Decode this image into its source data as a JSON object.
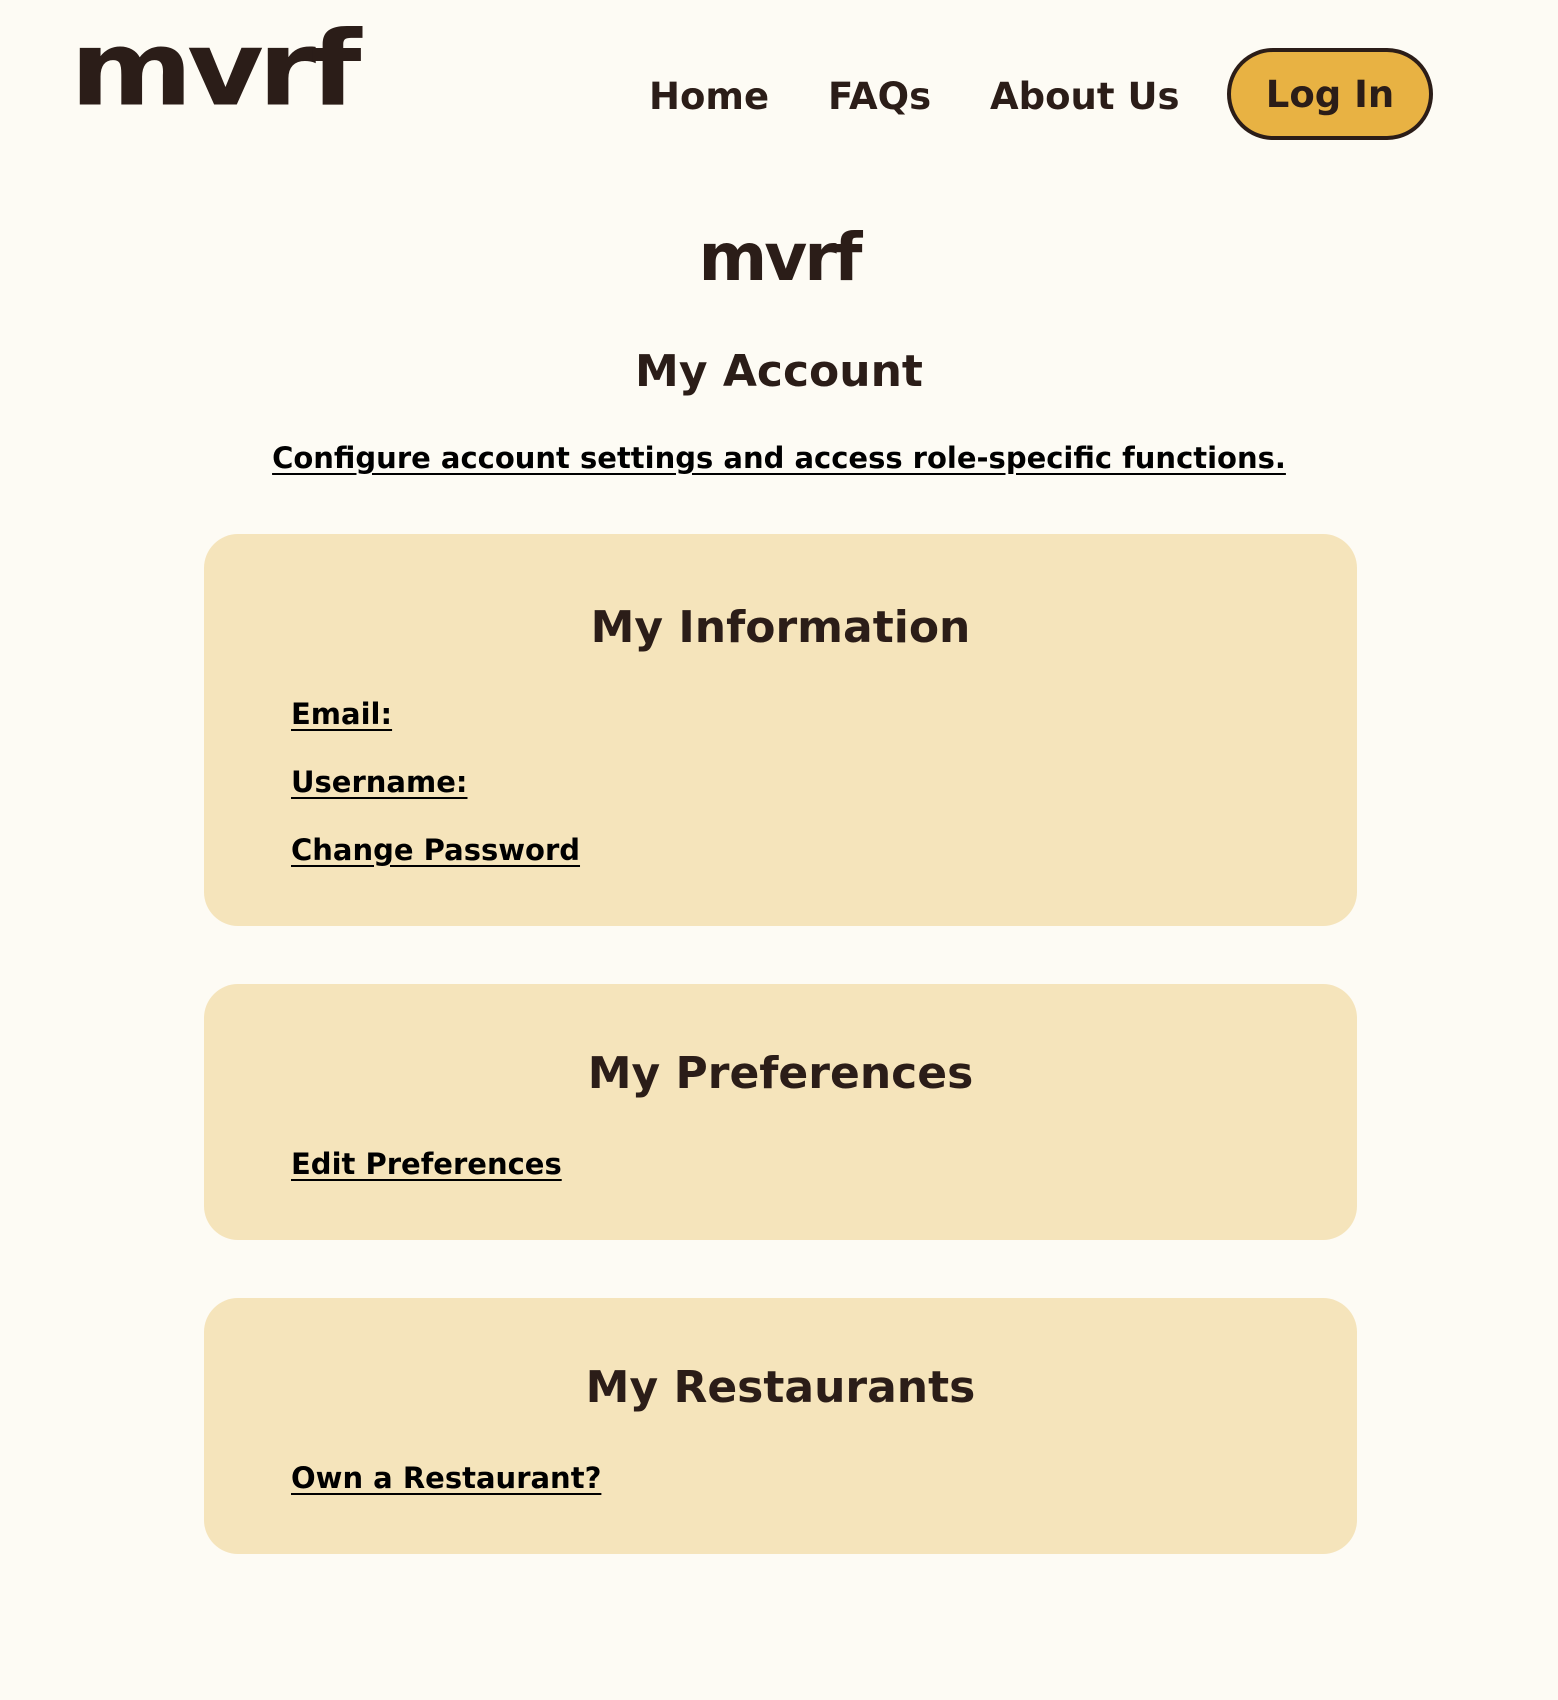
{
  "header": {
    "logo_text": "mvrf",
    "nav": {
      "home": "Home",
      "faqs": "FAQs",
      "about": "About Us"
    },
    "login_label": "Log In"
  },
  "main": {
    "logo_text": "mvrf",
    "title": "My Account",
    "subtitle": "Configure account settings and access role-specific functions."
  },
  "cards": {
    "information": {
      "title": "My Information",
      "email_label": "Email:",
      "username_label": "Username:",
      "change_password_label": "Change Password"
    },
    "preferences": {
      "title": "My Preferences",
      "edit_label": "Edit Preferences"
    },
    "restaurants": {
      "title": "My Restaurants",
      "own_label": "Own a Restaurant?"
    }
  },
  "colors": {
    "background": "#fdfbf4",
    "text": "#2b1d18",
    "card_background": "#f5e4bb",
    "login_button": "#e8b243"
  }
}
